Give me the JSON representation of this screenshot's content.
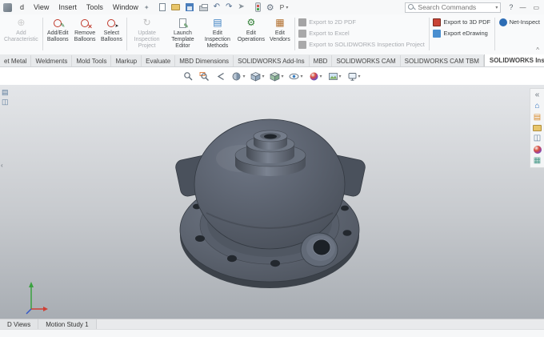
{
  "app": {
    "search": {
      "placeholder": "Search Commands"
    },
    "quickbar_more_label": "P"
  },
  "menubar": {
    "items": [
      "d",
      "View",
      "Insert",
      "Tools",
      "Window"
    ]
  },
  "ribbon": {
    "large_buttons": [
      {
        "label": "Add Characteristic",
        "enabled": false
      },
      {
        "label": "Add/Edit Balloons",
        "enabled": true
      },
      {
        "label": "Remove Balloons",
        "enabled": true
      },
      {
        "label": "Select Balloons",
        "enabled": true
      },
      {
        "label": "Update Inspection Project",
        "enabled": false
      },
      {
        "label": "Launch Template Editor",
        "enabled": true
      },
      {
        "label": "Edit Inspection Methods",
        "enabled": true
      },
      {
        "label": "Edit Operations",
        "enabled": true
      },
      {
        "label": "Edit Vendors",
        "enabled": true
      }
    ],
    "export_group_1": [
      {
        "label": "Export to 2D PDF",
        "enabled": false
      },
      {
        "label": "Export to Excel",
        "enabled": false
      },
      {
        "label": "Export to SOLIDWORKS Inspection Project",
        "enabled": false
      }
    ],
    "export_group_2": [
      {
        "label": "Export to 3D PDF",
        "enabled": true
      },
      {
        "label": "Export eDrawing",
        "enabled": true
      }
    ],
    "net_inspect_label": "Net-Inspect"
  },
  "ribbon_tabs": {
    "items": [
      "et Metal",
      "Weldments",
      "Mold Tools",
      "Markup",
      "Evaluate",
      "MBD Dimensions",
      "SOLIDWORKS Add-Ins",
      "MBD",
      "SOLIDWORKS CAM",
      "SOLIDWORKS CAM TBM",
      "SOLIDWORKS Inspection"
    ],
    "active": "SOLIDWORKS Inspection"
  },
  "bottom_bar": {
    "tabs": [
      "D Views",
      "Motion Study 1"
    ]
  },
  "colors": {
    "model_gray": "#555c68",
    "model_dark": "#3c424a",
    "viewport_top": "#e4e6e9",
    "viewport_bottom": "#a8adb3",
    "balloon_red": "#c0392b",
    "accent_blue": "#3a7fc1"
  }
}
